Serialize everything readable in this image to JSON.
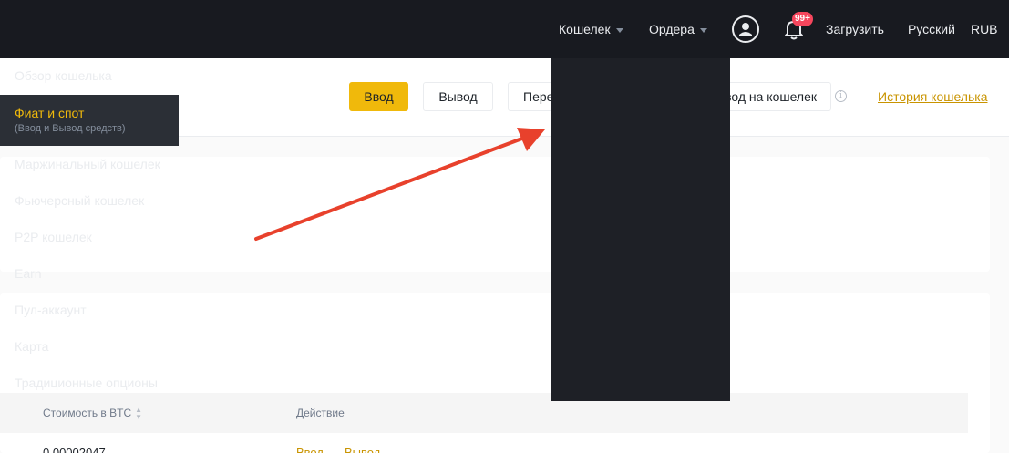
{
  "topbar": {
    "wallet_label": "Кошелек",
    "orders_label": "Ордера",
    "notifications_badge": "99+",
    "download_label": "Загрузить",
    "language_label": "Русский",
    "currency_label": "RUB"
  },
  "header": {
    "buttons": [
      "Ввод",
      "Вывод",
      "Пере",
      "вод на кошелек"
    ],
    "history_link": "История кошелька",
    "info_icon": "i"
  },
  "table": {
    "columns": [
      "Стоимость в BTC",
      "Действие"
    ],
    "rows": [
      {
        "btc_value": "0.00002047",
        "actions": [
          "Ввод",
          "Вывод"
        ]
      }
    ]
  },
  "wallet_menu": {
    "items": [
      {
        "label": "Обзор кошелька"
      },
      {
        "label": "Фиат и спот",
        "sublabel": "(Ввод и Вывод средств)",
        "active": true
      },
      {
        "label": "Маржинальный кошелек"
      },
      {
        "label": "Фьючерсный кошелек"
      },
      {
        "label": "P2P кошелек"
      },
      {
        "label": "Earn"
      },
      {
        "label": "Пул-аккаунт"
      },
      {
        "label": "Карта"
      },
      {
        "label": "Традиционные опционы"
      }
    ]
  },
  "colors": {
    "accent": "#f0b90b",
    "topbar_bg": "#181a20",
    "menu_bg": "#1e2026",
    "annotation_arrow": "#e8412c"
  }
}
